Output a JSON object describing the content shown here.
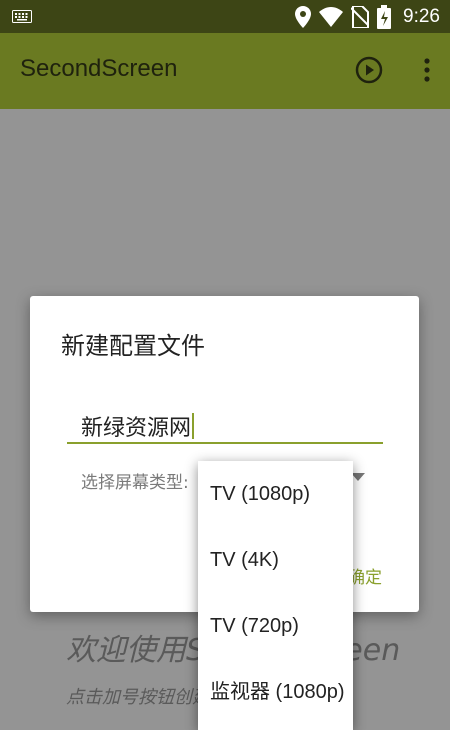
{
  "status_bar": {
    "time": "9:26"
  },
  "app_bar": {
    "title": "SecondScreen"
  },
  "main": {
    "welcome": "欢迎使用SecondScreen",
    "hint": "点击加号按钮创建配置文件"
  },
  "dialog": {
    "title": "新建配置文件",
    "name_value": "新绿资源网",
    "screen_type_label": "选择屏幕类型:",
    "ok_label": "确定"
  },
  "dropdown": {
    "options": [
      "TV (1080p)",
      "TV (4K)",
      "TV (720p)",
      "监视器 (1080p)"
    ]
  },
  "colors": {
    "status_bar": "#3d4515",
    "app_bar": "#6a7a21",
    "accent": "#8aa02d"
  }
}
